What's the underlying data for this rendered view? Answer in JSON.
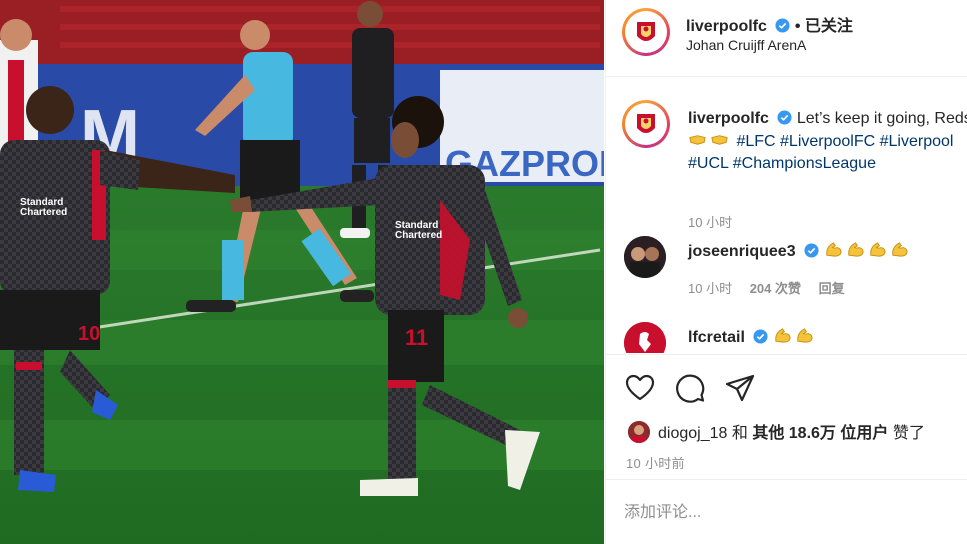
{
  "post": {
    "image_alt_icon": "football-photo",
    "brand_color": "#c8102e"
  },
  "header": {
    "username": "liverpoolfc",
    "follow_status": "• 已关注",
    "location": "Johan Cruijff ArenA"
  },
  "caption": {
    "username": "liverpoolfc",
    "text": "Let’s keep it going, Reds!",
    "hashtags": "#LFC #LiverpoolFC #Liverpool #UCL #ChampionsLeague",
    "time": "10 小时"
  },
  "comments": [
    {
      "username": "joseenriquee3",
      "emoji": "flexed-biceps x4",
      "time": "10 小时",
      "likes": "204 次赞",
      "reply": "回复"
    },
    {
      "username": "lfcretail",
      "emoji": "flexed-biceps x2"
    }
  ],
  "actions": {
    "like_icon": "heart-icon",
    "comment_icon": "comment-icon",
    "share_icon": "send-icon"
  },
  "likes_line": {
    "user": "diogoj_18",
    "and": "和",
    "others": "其他 18.6万 位用户",
    "suffix": "赞了"
  },
  "timeago": "10 小时前",
  "comment_input": {
    "placeholder": "添加评论..."
  }
}
